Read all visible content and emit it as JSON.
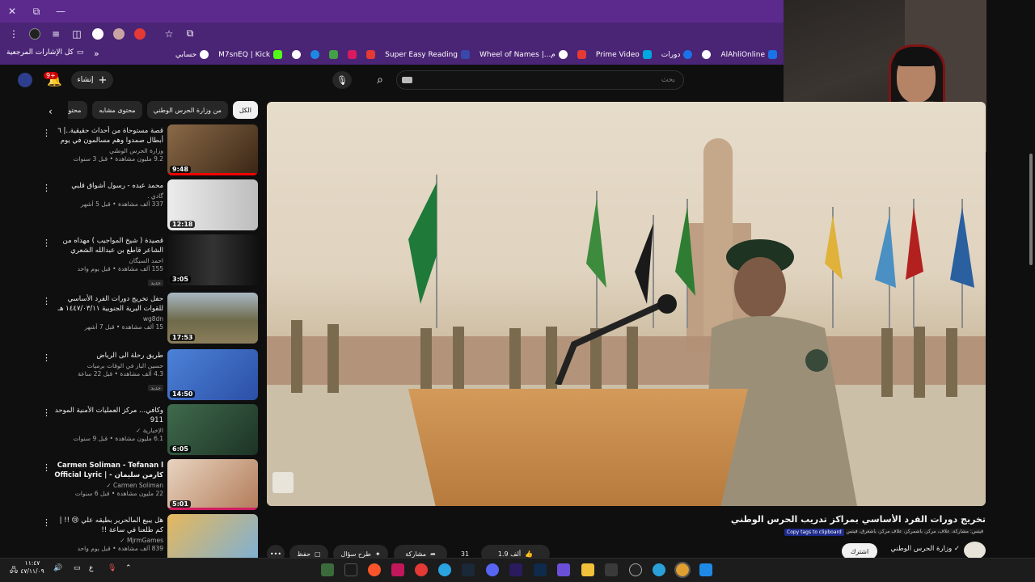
{
  "browser": {
    "window_controls": {
      "close": "✕",
      "restore": "⧉",
      "minimize": "—"
    },
    "bookmarks": [
      {
        "label": "AlAhliOnline",
        "color": "#1a73e8"
      },
      {
        "label": "",
        "color": "#ffffff"
      },
      {
        "label": "دورات",
        "color": "#1a73e8"
      },
      {
        "label": "Prime Video",
        "color": "#00a8e1"
      },
      {
        "label": "",
        "color": "#e53935"
      },
      {
        "label": "م...| Wheel of Names",
        "color": "#ffffff"
      },
      {
        "label": "Super Easy Reading",
        "color": "#3949ab"
      },
      {
        "label": "",
        "color": "#e53935"
      },
      {
        "label": "",
        "color": "#d81b60"
      },
      {
        "label": "",
        "color": "#43a047"
      },
      {
        "label": "",
        "color": "#1e88e5"
      },
      {
        "label": "",
        "color": "#ffffff"
      },
      {
        "label": "M7snEQ | Kick",
        "color": "#53fc18"
      },
      {
        "label": "حسابي",
        "color": "#ffffff"
      }
    ],
    "bookmarks_more": "»",
    "all_bookmarks": "كل الإشارات المرجعية"
  },
  "header": {
    "create_label": "إنشاء",
    "notification_count": "9+",
    "search_placeholder": "بحث"
  },
  "chips": [
    {
      "label": "الكل",
      "active": true
    },
    {
      "label": "من وزارة الحرس الوطني",
      "active": false
    },
    {
      "label": "محتوى مشابه",
      "active": false
    },
    {
      "label": "محتوى يه...",
      "active": false
    }
  ],
  "related": [
    {
      "title": "قصة مستوحاة من أحداث حقيقية..| ٦ أبطال صمدوا وهم مسالمون في يوم #عشرة_واحد...",
      "channel": "وزارة الحرس الوطني",
      "stats": "9.2 مليون مشاهدة • قبل 3 سنوات",
      "duration": "9:48",
      "is_new": false,
      "progress": 1.0,
      "thumb_color": "#6b4a2e"
    },
    {
      "title": "محمد عبده - رسول أشواق قلبي",
      "channel": "گادي .",
      "stats": "337 ألف مشاهدة • قبل 5 أشهر",
      "duration": "12:18",
      "is_new": false,
      "progress": 0,
      "thumb_color": "#d9d9d9"
    },
    {
      "title": "قصيدة ( شيخ المواجيب ) مهداه من الشاعر قاطع بن عبدالله الشعري لرجل الأعمال احم...",
      "channel": "احمد السيگان",
      "stats": "155 ألف مشاهدة • قبل يوم واحد",
      "duration": "3:05",
      "is_new": true,
      "progress": 0,
      "thumb_color": "#1a1a1a"
    },
    {
      "title": "حفل تخريج دورات الفرد الأساسي للقوات البرية الجنوبية ١٤٤٧/٠٣/١١ هـ",
      "channel": "wg8dn",
      "stats": "15 ألف مشاهدة • قبل 7 أشهر",
      "duration": "17:53",
      "is_new": false,
      "progress": 0,
      "thumb_color": "#7a7a5a"
    },
    {
      "title": "طريق رحلة الى الرياض",
      "channel": "حسين الباز في الوقات برميات",
      "stats": "4.3 ألف مشاهدة • قبل 22 ساعة",
      "duration": "14:50",
      "is_new": true,
      "progress": 0,
      "thumb_color": "#3b6fc4"
    },
    {
      "title": "وكافي... مركز العمليات الأمنية الموحد 911",
      "channel": "الإخبارية ✓",
      "stats": "6.1 مليون مشاهدة • قبل 9 سنوات",
      "duration": "6:05",
      "is_new": false,
      "progress": 0,
      "thumb_color": "#2f4a3a"
    },
    {
      "title": "Carmen Soliman - Tefanan l كارمن سليمان - | Official Lyric Video...",
      "channel": "Carmen Soliman ✓",
      "stats": "22 مليون مشاهدة • قبل 6 سنوات",
      "duration": "5:01",
      "is_new": false,
      "progress": 0,
      "thumb_color": "#c79a7a"
    },
    {
      "title": "هل يبيع المالحرير بطيقه علي 😢 !! | كم طلعنا في ساعة !!",
      "channel": "MjrmGames ✓",
      "stats": "839 ألف مشاهدة • قبل يوم واحد",
      "duration": "",
      "is_new": false,
      "progress": 0,
      "thumb_color": "#d4a24a"
    }
  ],
  "video": {
    "title": "تخريج دورات الفرد الأساسي بمراكز تدريب الحرس الوطني",
    "tags_line": "فيتس: مشاركة، علاف، مركز، باشمركز، علاف مركز، باشعرق، فيتس، مسابقة، تحميل",
    "copy_tags": "Copy tags to clipboard",
    "channel": "وزارة الحرس الوطني",
    "subscribe_label": "اشترك",
    "like_count": "1.9 ألف",
    "comments_count": "31",
    "share_label": "مشاركة",
    "ask_label": "طرح سؤال",
    "save_label": "حفظ",
    "more_label": "•••"
  },
  "taskbar": {
    "time": "١١:٤٧",
    "date": "٤٧/١١/٠٩",
    "lang": "ع"
  }
}
